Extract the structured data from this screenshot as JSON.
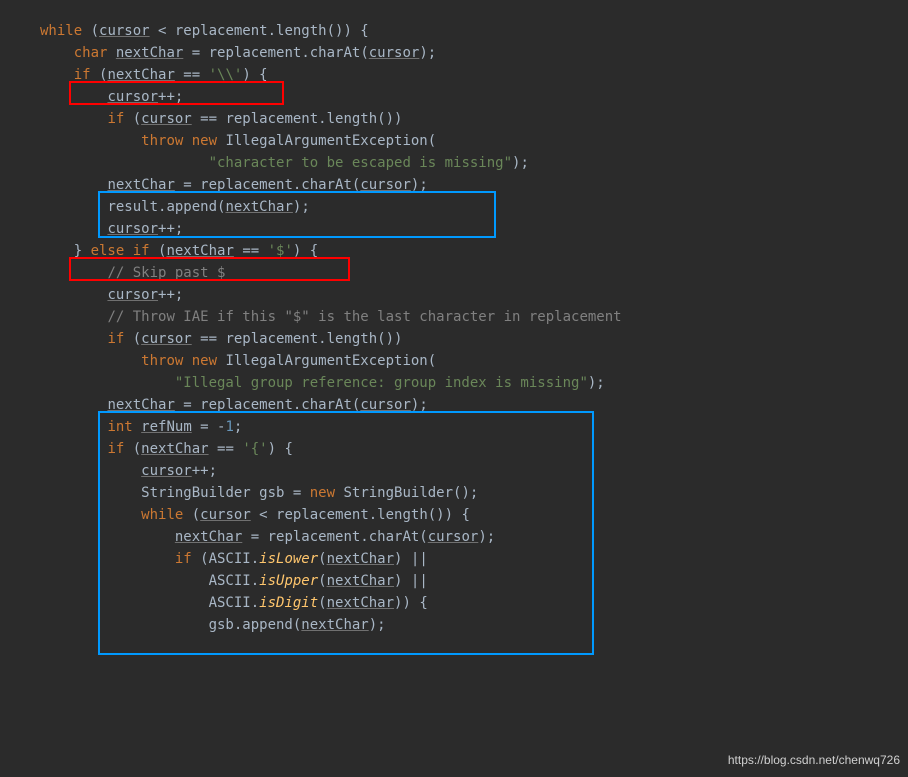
{
  "code": {
    "l1_kw1": "while",
    "l1_var1": "cursor",
    "l1_txt1": " < replacement.length()) {",
    "l2_kw1": "char",
    "l2_var1": "nextChar",
    "l2_txt1": " = replacement.charAt(",
    "l2_var2": "cursor",
    "l2_txt2": ");",
    "l3_kw1": "if",
    "l3_txt1": " (",
    "l3_var1": "nextChar",
    "l3_txt2": " == ",
    "l3_str1": "'\\\\'",
    "l3_txt3": ") {",
    "l4_var1": "cursor",
    "l4_txt1": "++;",
    "l5_kw1": "if",
    "l5_txt1": " (",
    "l5_var1": "cursor",
    "l5_txt2": " == replacement.length())",
    "l6_kw1": "throw new",
    "l6_txt1": " IllegalArgumentException(",
    "l7_str1": "\"character to be escaped is missing\"",
    "l7_txt1": ");",
    "l8_var1": "nextChar",
    "l8_txt1": " = replacement.charAt(",
    "l8_var2": "cursor",
    "l8_txt2": ");",
    "l9_txt1": "result.append(",
    "l9_var1": "nextChar",
    "l9_txt2": ");",
    "l10_var1": "cursor",
    "l10_txt1": "++;",
    "l11_txt1": "} ",
    "l11_kw1": "else if",
    "l11_txt2": " (",
    "l11_var1": "nextChar",
    "l11_txt3": " == ",
    "l11_str1": "'$'",
    "l11_txt4": ") {",
    "l12_cmt1": "// Skip past $",
    "l13_var1": "cursor",
    "l13_txt1": "++;",
    "l14_cmt1": "// Throw IAE if this \"$\" is the last character in replacement",
    "l15_kw1": "if",
    "l15_txt1": " (",
    "l15_var1": "cursor",
    "l15_txt2": " == replacement.length())",
    "l16_kw1": "throw new",
    "l16_txt1": " IllegalArgumentException(",
    "l17_str1": "\"Illegal group reference: group index is missing\"",
    "l17_txt1": ");",
    "l18_var1": "nextChar",
    "l18_txt1": " = replacement.charAt(",
    "l18_var2": "cursor",
    "l18_txt2": ");",
    "l19_kw1": "int",
    "l19_var1": "refNum",
    "l19_txt1": " = -",
    "l19_num1": "1",
    "l19_txt2": ";",
    "l20_kw1": "if",
    "l20_txt1": " (",
    "l20_var1": "nextChar",
    "l20_txt2": " == ",
    "l20_str1": "'{'",
    "l20_txt3": ") {",
    "l21_var1": "cursor",
    "l21_txt1": "++;",
    "l22_txt1": "StringBuilder gsb = ",
    "l22_kw1": "new",
    "l22_txt2": " StringBuilder();",
    "l23_kw1": "while",
    "l23_txt1": " (",
    "l23_var1": "cursor",
    "l23_txt2": " < replacement.length()) {",
    "l24_var1": "nextChar",
    "l24_txt1": " = replacement.charAt(",
    "l24_var2": "cursor",
    "l24_txt2": ");",
    "l25_kw1": "if",
    "l25_txt1": " (ASCII.",
    "l25_meth1": "isLower",
    "l25_txt2": "(",
    "l25_var1": "nextChar",
    "l25_txt3": ") ||",
    "l26_txt1": "ASCII.",
    "l26_meth1": "isUpper",
    "l26_txt2": "(",
    "l26_var1": "nextChar",
    "l26_txt3": ") ||",
    "l27_txt1": "ASCII.",
    "l27_meth1": "isDigit",
    "l27_txt2": "(",
    "l27_var1": "nextChar",
    "l27_txt3": ")) {",
    "l28_txt1": "gsb.append(",
    "l28_var1": "nextChar",
    "l28_txt2": ");"
  },
  "watermark": "https://blog.csdn.net/chenwq726"
}
